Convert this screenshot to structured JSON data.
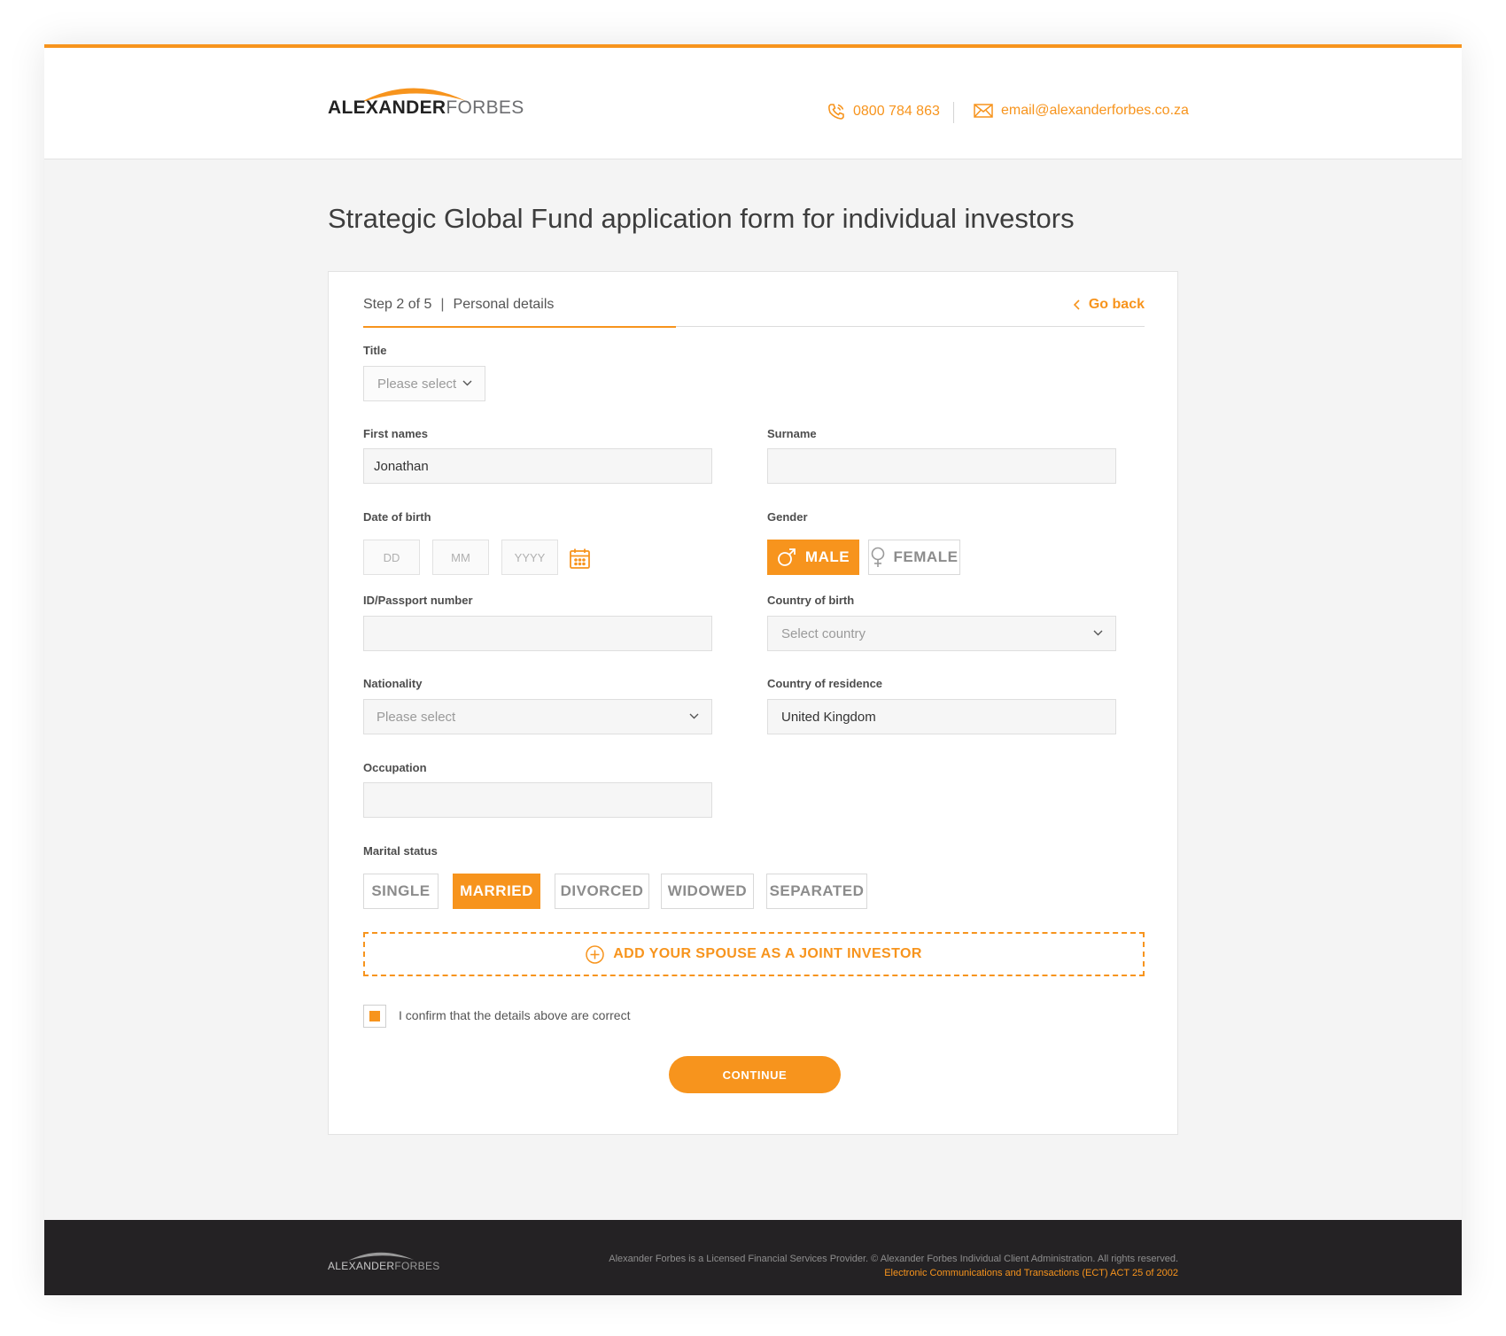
{
  "header": {
    "logo_main": "ALEXANDER",
    "logo_sub": "FORBES",
    "phone": "0800 784 863",
    "email": "email@alexanderforbes.co.za"
  },
  "page_title": "Strategic Global Fund application form for individual investors",
  "step": {
    "indicator": "Step 2 of 5",
    "separator": "|",
    "name": "Personal details",
    "go_back": "Go back",
    "progress": 0.4
  },
  "form": {
    "title": {
      "label": "Title",
      "value": "Please select"
    },
    "first_names": {
      "label": "First names",
      "value": "Jonathan"
    },
    "surname": {
      "label": "Surname",
      "value": ""
    },
    "dob": {
      "label": "Date of birth",
      "dd": "DD",
      "mm": "MM",
      "yyyy": "YYYY"
    },
    "gender": {
      "label": "Gender",
      "options": [
        "MALE",
        "FEMALE"
      ],
      "selected": "MALE"
    },
    "id_number": {
      "label": "ID/Passport number",
      "value": ""
    },
    "country_of_birth": {
      "label": "Country of birth",
      "value": "Select country"
    },
    "nationality": {
      "label": "Nationality",
      "value": "Please select"
    },
    "country_of_residence": {
      "label": "Country of residence",
      "value": "United Kingdom"
    },
    "occupation": {
      "label": "Occupation",
      "value": ""
    },
    "marital_status": {
      "label": "Marital status",
      "options": [
        "SINGLE",
        "MARRIED",
        "DIVORCED",
        "WIDOWED",
        "SEPARATED"
      ],
      "selected": "MARRIED"
    },
    "add_spouse": "ADD YOUR SPOUSE AS A JOINT INVESTOR",
    "confirm": "I confirm that the details above are correct",
    "confirm_checked": true,
    "continue": "CONTINUE"
  },
  "footer": {
    "logo_main": "ALEXANDER",
    "logo_sub": "FORBES",
    "legal_line1": "Alexander Forbes is a Licensed Financial Services Provider. © Alexander Forbes Individual Client Administration. All rights reserved.",
    "legal_line2": "Electronic Communications and Transactions (ECT) ACT 25 of 2002"
  },
  "colors": {
    "accent": "#f7941d",
    "footer_bg": "#242224",
    "page_bg": "#f4f4f4"
  }
}
